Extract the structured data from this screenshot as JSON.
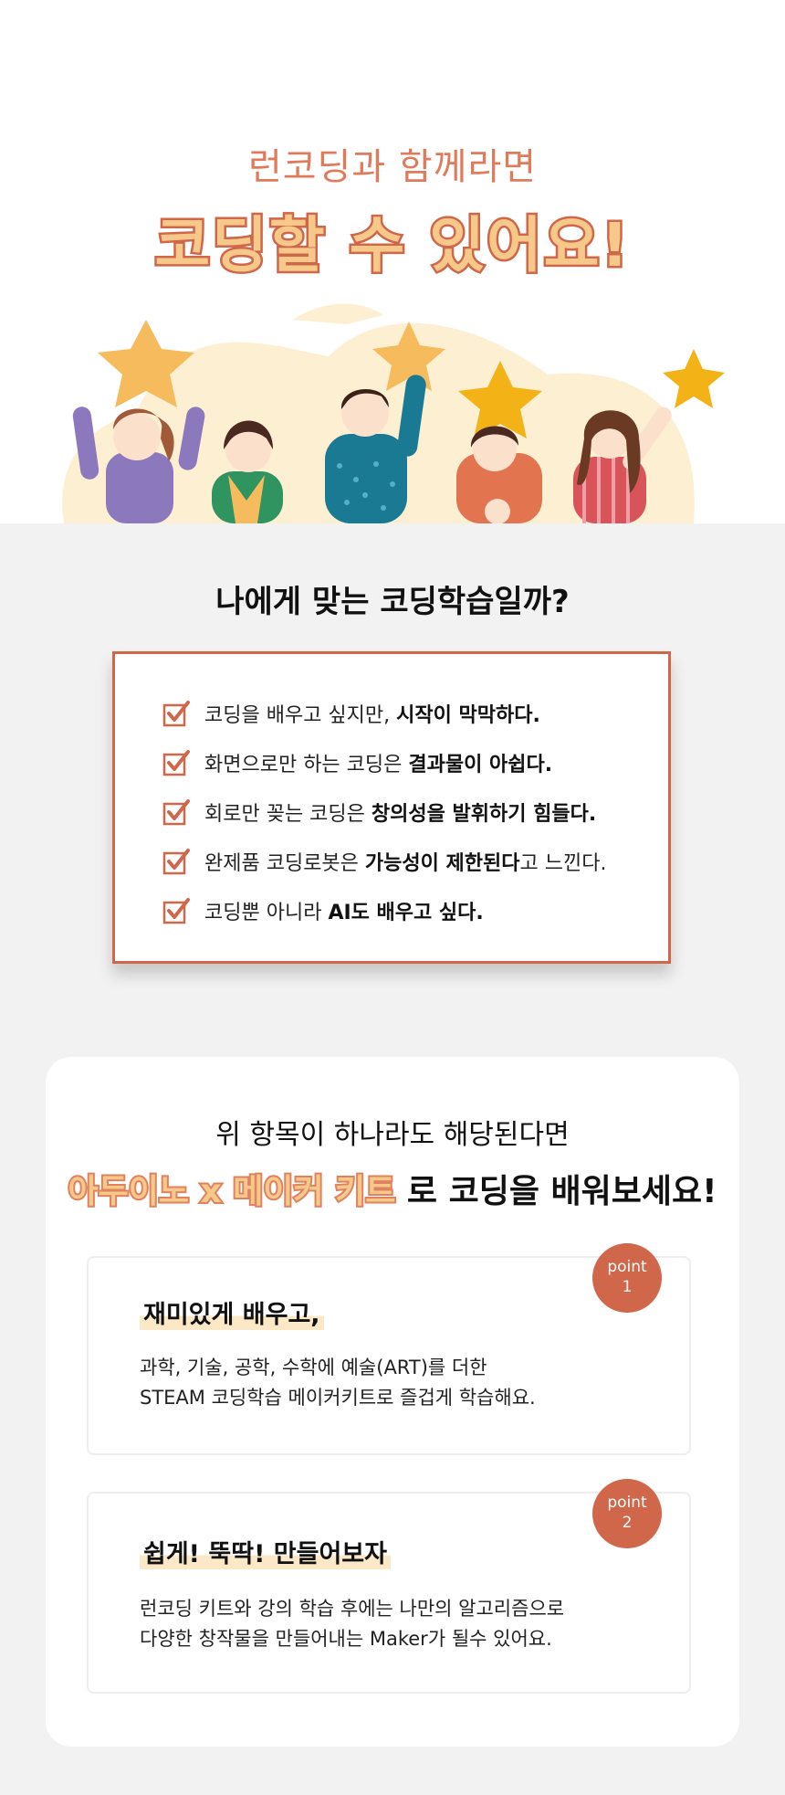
{
  "hero": {
    "subtitle": "런코딩과 함께라면",
    "title": "코딩할 수 있어요!"
  },
  "questions": {
    "title": "나에게 맞는 코딩학습일까?",
    "items": [
      {
        "plain": "코딩을 배우고 싶지만, ",
        "bold": "시작이 막막하다.",
        "tail": ""
      },
      {
        "plain": "화면으로만 하는 코딩은 ",
        "bold": "결과물이 아쉽다.",
        "tail": ""
      },
      {
        "plain": "회로만 꽂는 코딩은 ",
        "bold": "창의성을 발휘하기 힘들다.",
        "tail": ""
      },
      {
        "plain": "완제품 코딩로봇은 ",
        "bold": "가능성이 제한된다",
        "tail": "고 느낀다."
      },
      {
        "plain": "코딩뿐 아니라 ",
        "bold": "AI도 배우고 싶다.",
        "tail": ""
      }
    ]
  },
  "recommend": {
    "lead": "위 항목이 하나라도 해당된다면",
    "brand": "아두이노 x 메이커 키트",
    "headline_rest": " 로 코딩을 배워보세요!"
  },
  "points": [
    {
      "badge_word": "point",
      "badge_num": "1",
      "heading": "재미있게 배우고,",
      "desc": "과학, 기술, 공학, 수학에 예술(ART)를 더한\nSTEAM 코딩학습 메이커키트로 즐겁게 학습해요."
    },
    {
      "badge_word": "point",
      "badge_num": "2",
      "heading": "쉽게! 뚝딱! 만들어보자",
      "desc": "런코딩 키트와 강의 학습 후에는 나만의 알고리즘으로\n다양한 창작물을 만들어내는 Maker가 될수 있어요."
    }
  ],
  "colors": {
    "accent": "#d0664a",
    "accent_light": "#f6c98a",
    "highlight": "#fbe8c7",
    "background": "#f2f2f2"
  }
}
